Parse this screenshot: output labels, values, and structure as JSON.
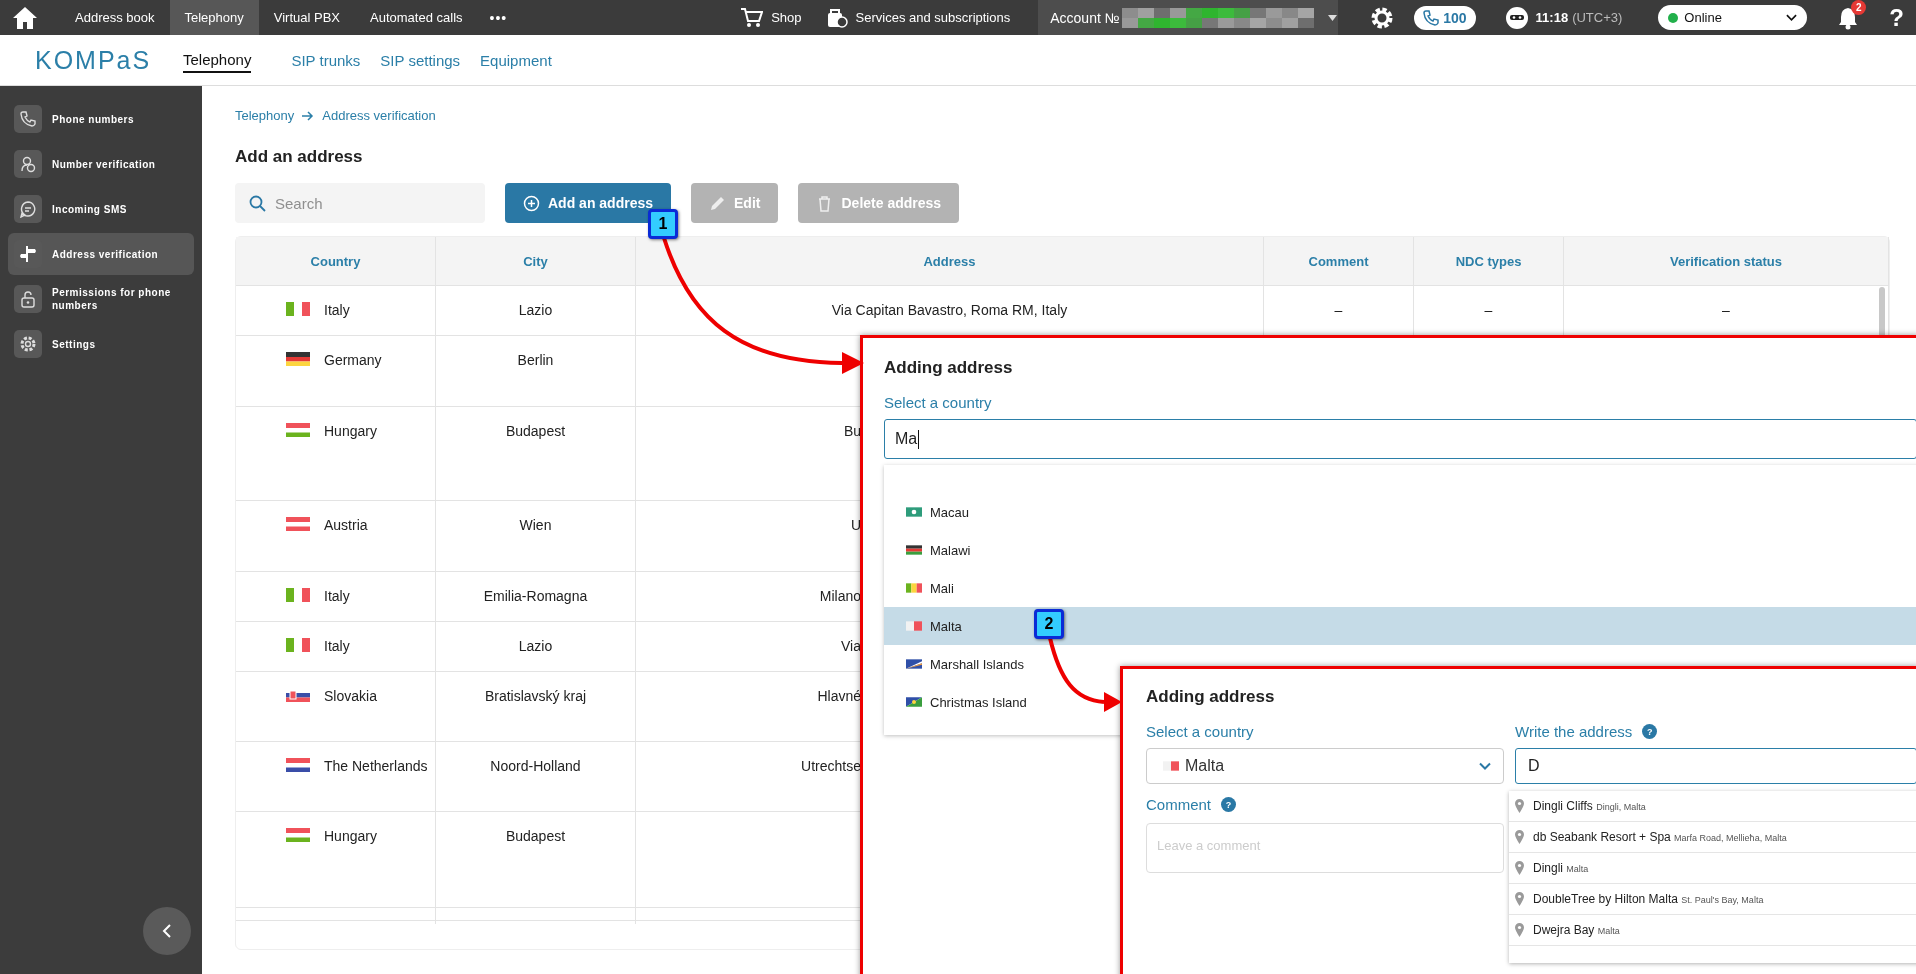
{
  "top_bar": {
    "nav": [
      {
        "label": "Address book",
        "selected": false
      },
      {
        "label": "Telephony",
        "selected": true
      },
      {
        "label": "Virtual PBX",
        "selected": false
      },
      {
        "label": "Automated calls",
        "selected": false
      }
    ],
    "more": "•••",
    "shop": "Shop",
    "services": "Services and subscriptions",
    "account": "Account №",
    "calls": "100",
    "time": "11:18",
    "timezone": "(UTC+3)",
    "status": "Online",
    "notifications": "2",
    "help": "?"
  },
  "header": {
    "logo": "KOMPaS",
    "tabs": [
      {
        "label": "Telephony",
        "selected": true
      },
      {
        "label": "SIP trunks",
        "selected": false
      },
      {
        "label": "SIP settings",
        "selected": false
      },
      {
        "label": "Equipment",
        "selected": false
      }
    ]
  },
  "sidebar": {
    "items": [
      {
        "label": "Phone numbers",
        "kind": "phone",
        "selected": false
      },
      {
        "label": "Number verification",
        "kind": "verify",
        "selected": false
      },
      {
        "label": "Incoming SMS",
        "kind": "sms",
        "selected": false
      },
      {
        "label": "Address verification",
        "kind": "signpost",
        "selected": true
      },
      {
        "label": "Permissions for phone numbers",
        "kind": "lock",
        "selected": false
      },
      {
        "label": "Settings",
        "kind": "settings",
        "selected": false
      }
    ]
  },
  "breadcrumb": [
    "Telephony",
    "Address verification"
  ],
  "title": "Add an address",
  "toolbar": {
    "search_placeholder": "Search",
    "buttons": [
      {
        "label": "Add an address",
        "kind": "add",
        "disabled": false
      },
      {
        "label": "Edit",
        "kind": "edit",
        "disabled": true
      },
      {
        "label": "Delete address",
        "kind": "delete",
        "disabled": true
      }
    ]
  },
  "table": {
    "columns": [
      "Country",
      "City",
      "Address",
      "Comment",
      "NDC types",
      "Verification status"
    ],
    "rows": [
      {
        "kind": "it",
        "country": "Italy",
        "city": "Lazio",
        "address": "Via Capitan Bavastro, Roma RM, Italy",
        "covered": false,
        "comment": "–",
        "ndc_types": "–",
        "verification_status": "–"
      },
      {
        "kind": "de",
        "country": "Germany",
        "city": "Berlin"
      },
      {
        "kind": "hu",
        "country": "Hungary",
        "city": "Budapest",
        "address": "Bu",
        "covered": true
      },
      {
        "kind": "at",
        "country": "Austria",
        "city": "Wien",
        "address": "U",
        "covered": true
      },
      {
        "kind": "it",
        "country": "Italy",
        "city": "Emilia-Romagna",
        "address": "Milano",
        "covered": true
      },
      {
        "kind": "it",
        "country": "Italy",
        "city": "Lazio",
        "address": "Via",
        "covered": true
      },
      {
        "kind": "sk",
        "country": "Slovakia",
        "city": "Bratislavský kraj",
        "address": "Hlavné",
        "covered": true
      },
      {
        "kind": "nl",
        "country": "The Netherlands",
        "city": "Noord-Holland",
        "address": "Utrechtse",
        "covered": true
      },
      {
        "kind": "hu",
        "country": "Hungary",
        "city": "Budapest"
      }
    ]
  },
  "panel_country": {
    "title": "Adding address",
    "country_label": "Select a country",
    "country_value": "Ma",
    "options": [
      {
        "label": "Macau",
        "kind": "mo",
        "selected": false
      },
      {
        "label": "Malawi",
        "kind": "mw",
        "selected": false
      },
      {
        "label": "Mali",
        "kind": "ml",
        "selected": false
      },
      {
        "label": "Malta",
        "kind": "mt",
        "selected": true
      },
      {
        "label": "Marshall Islands",
        "kind": "mh",
        "selected": false
      },
      {
        "label": "Christmas Island",
        "kind": "cx",
        "selected": false
      }
    ]
  },
  "panel_address": {
    "title": "Adding address",
    "country_label": "Select a country",
    "country": {
      "label": "Malta",
      "kind": "mt"
    },
    "address_label": "Write the address",
    "address_help": "?",
    "address_value": "D",
    "comment_label": "Comment",
    "comment_help": "?",
    "comment_placeholder": "Leave a comment",
    "suggestions": [
      {
        "name": "Dingli Cliffs",
        "detail": "Dingli, Malta"
      },
      {
        "name": "db Seabank Resort + Spa",
        "detail": "Marfa Road, Mellieħa, Malta"
      },
      {
        "name": "Dingli",
        "detail": "Malta"
      },
      {
        "name": "DoubleTree by Hilton Malta",
        "detail": "St. Paul's Bay, Malta"
      },
      {
        "name": "Dwejra Bay",
        "detail": "Malta"
      }
    ]
  },
  "callouts": [
    "1",
    "2"
  ]
}
